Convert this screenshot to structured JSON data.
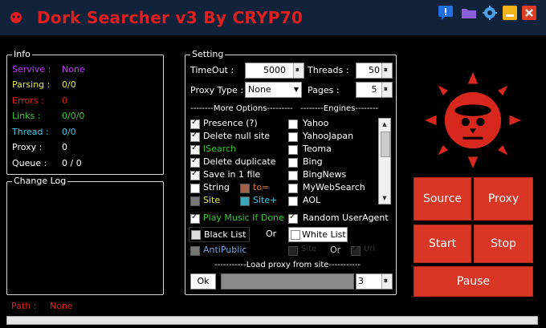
{
  "window": {
    "title": "Dork Searcher v3 By CRYP70"
  },
  "info": {
    "label": "Info",
    "rows": [
      {
        "label": "Servive :",
        "value": "None",
        "color": "#c63cff"
      },
      {
        "label": "Parsing :",
        "value": "0/0",
        "color": "#e5e54a"
      },
      {
        "label": "Errors :",
        "value": "0",
        "color": "#e02020"
      },
      {
        "label": "Links :",
        "value": "0/0/0",
        "color": "#37c837"
      },
      {
        "label": "Thread :",
        "value": "0/0",
        "color": "#40c8e8"
      },
      {
        "label": "Proxy :",
        "value": "0",
        "color": "#ffffff"
      },
      {
        "label": "Queue :",
        "value": "0 / 0",
        "color": "#ffffff"
      }
    ]
  },
  "changelog": {
    "label": "Change Log"
  },
  "setting": {
    "label": "Setting",
    "timeout_label": "TimeOut :",
    "timeout_value": "5000",
    "threads_label": "Threads :",
    "threads_value": "50",
    "proxytype_label": "Proxy Type :",
    "proxytype_value": "None",
    "pages_label": "Pages :",
    "pages_value": "5",
    "more_options_header": "--------More Options---------",
    "engines_header": "--------Engines--------",
    "options": [
      {
        "label": "Presence (?)",
        "checked": true,
        "color": "#ffffff"
      },
      {
        "label": "Delete null site",
        "checked": true,
        "color": "#ffffff"
      },
      {
        "label": "ISearch",
        "checked": true,
        "color": "#37c837"
      },
      {
        "label": "Delete duplicate",
        "checked": true,
        "color": "#ffffff"
      },
      {
        "label": "Save in 1 file",
        "checked": true,
        "color": "#ffffff"
      }
    ],
    "string_label": "String",
    "to_label": "to=",
    "site_label": "Site",
    "siteplus_label": "Site+",
    "engines": [
      "Yahoo",
      "YahooJapan",
      "Teoma",
      "Bing",
      "BingNews",
      "MyWebSearch",
      "AOL"
    ],
    "play_music_label": "Play Music If Done",
    "random_ua_label": "Random UserAgent",
    "black_list_label": "Black List",
    "or_label": "Or",
    "white_list_label": "White List",
    "antipublic_label": "AntiPublic",
    "site_dim_label": "Site",
    "or2_label": "Or",
    "url_dim_label": "Url",
    "load_proxy_header": "-----------Load proxy from site-----------",
    "ok_label": "Ok",
    "proxy_count_value": "3"
  },
  "buttons": {
    "source": "Source",
    "proxy": "Proxy",
    "start": "Start",
    "stop": "Stop",
    "pause": "Pause"
  },
  "path": {
    "label": "Path :",
    "value": "None"
  },
  "progress": 0
}
